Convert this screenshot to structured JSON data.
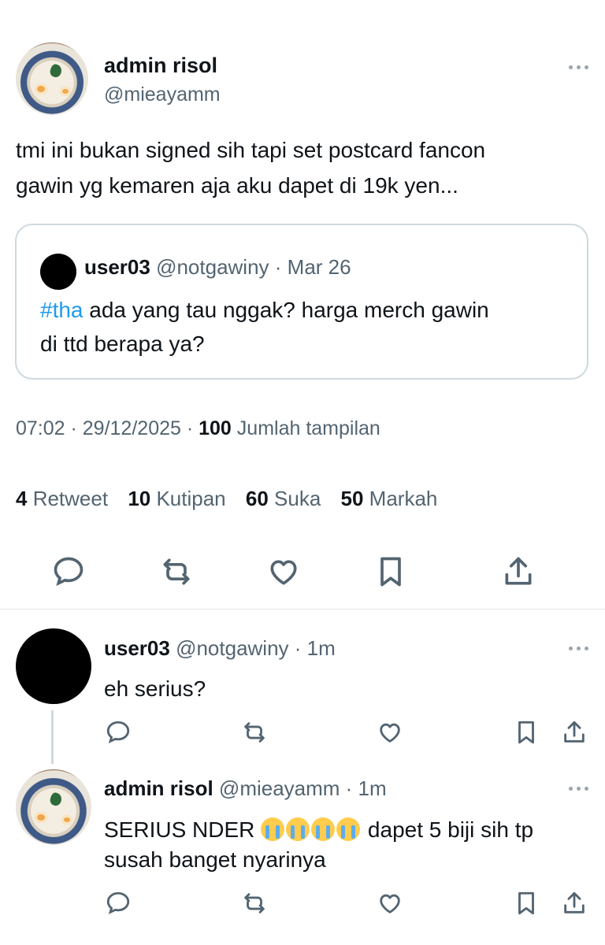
{
  "colors": {
    "accent": "#1d9bf0",
    "text": "#0f1419",
    "muted": "#536471",
    "border": "#cfd9de"
  },
  "tweet": {
    "author_name": "admin risol",
    "author_handle": "@mieayamm",
    "text_line1": "tmi ini bukan signed sih tapi set postcard fancon",
    "text_line2": "gawin yg kemaren aja aku dapet di 19k yen...",
    "quote": {
      "author_name": "user03",
      "author_handle": "@notgawiny",
      "date": "· Mar 26",
      "hashtag": "#tha",
      "text_line1": " ada yang tau nggak? harga merch gawin",
      "text_line2": "di ttd berapa ya?"
    },
    "time": "07:02 · 29/12/2025 · ",
    "views_count": "100",
    "views_label": " Jumlah tampilan",
    "stats": [
      {
        "count": "4",
        "label": " Retweet"
      },
      {
        "count": "10",
        "label": " Kutipan"
      },
      {
        "count": "60",
        "label": " Suka"
      },
      {
        "count": "50",
        "label": " Markah"
      }
    ],
    "actions": [
      "reply-icon",
      "retweet-icon",
      "like-icon",
      "bookmark-icon",
      "share-icon"
    ]
  },
  "replies": [
    {
      "author_name": "user03",
      "author_handle": " @notgawiny",
      "time": " · 1m",
      "text": "eh serius?"
    },
    {
      "author_name": "admin risol",
      "author_handle": " @mieayamm",
      "time": " · 1m",
      "text_prefix": "SERIUS NDER ",
      "emoji": "😭😭😭😭",
      "text_suffix": " dapet 5 biji sih tp",
      "text_line2": "susah banget nyarinya"
    }
  ]
}
